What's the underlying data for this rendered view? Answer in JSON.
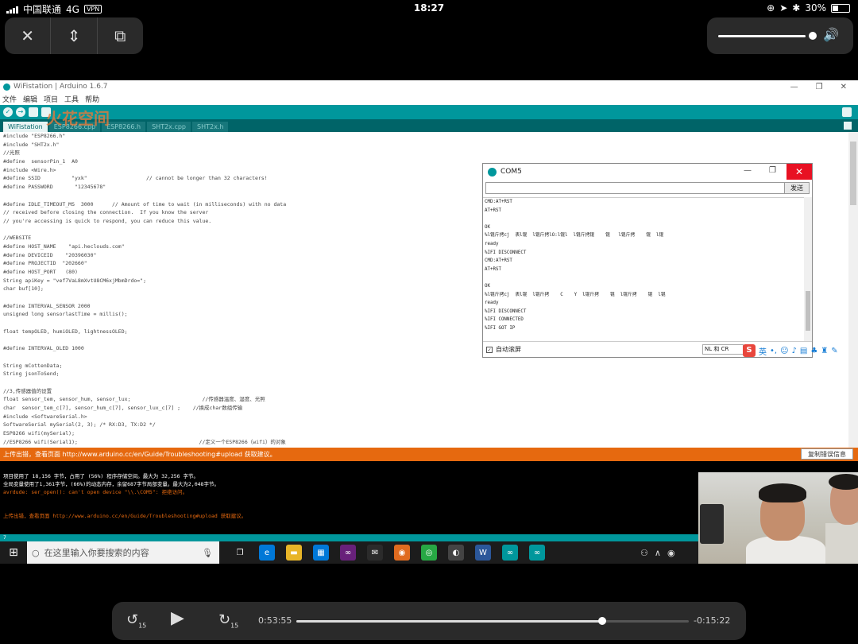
{
  "ios_status": {
    "carrier": "中国联通",
    "network": "4G",
    "vpn": "VPN",
    "time": "18:27",
    "battery": "30%"
  },
  "video_controls": {
    "close": "✕",
    "fullscreen": "⇕",
    "pip": "⧉",
    "volume_icon": "🔊"
  },
  "ide": {
    "title": "WiFistation | Arduino 1.6.7",
    "window_controls": [
      "—",
      "❐",
      "✕"
    ],
    "menu": [
      "文件",
      "编辑",
      "项目",
      "工具",
      "帮助"
    ],
    "watermark": "火花空间",
    "tabs": [
      "WiFistation",
      "ESP8266.cpp",
      "ESP8266.h",
      "SHT2x.cpp",
      "SHT2x.h"
    ],
    "code_lines": [
      "#include \"ESP8266.h\"",
      "#include \"SHT2x.h\"",
      "//光照",
      "#define  sensorPin_1  A0",
      "#include <Wire.h>",
      "#define SSID          \"yxk\"                   // cannot be longer than 32 characters!",
      "#define PASSWORD       \"12345678\"",
      "",
      "#define IDLE_TIMEOUT_MS  3000      // Amount of time to wait (in milliseconds) with no data",
      "// received before closing the connection.  If you know the server",
      "// you're accessing is quick to respond, you can reduce this value.",
      "",
      "//WEBSITE",
      "#define HOST_NAME    \"api.heclouds.com\"",
      "#define DEVICEID    \"20396030\"",
      "#define PROJECTID  \"202660\"",
      "#define HOST_PORT   (80)",
      "String apiKey = \"vef7VaL8mXvtU8CM6xjMbmDrdo=\";",
      "char buf[10];",
      "",
      "#define INTERVAL_SENSOR 2000",
      "unsigned long sensorlastTime = millis();",
      "",
      "float tempOLED, humiOLED, lightnessOLED;",
      "",
      "#define INTERVAL_OLED 1000",
      "",
      "String mCottenData;",
      "String jsonToSend;",
      "",
      "//3,传感器值的设置",
      "float sensor_tem, sensor_hum, sensor_lux;                       //传感器温度、湿度、光照",
      "char  sensor_tem_c[7], sensor_hum_c[7], sensor_lux_c[7] ;    //换成char数组传输",
      "#include <SoftwareSerial.h>",
      "SoftwareSerial mySerial(2, 3); /* RX:D3, TX:D2 */",
      "ESP8266 wifi(mySerial);",
      "//ESP8266 wifi(Serial1);                                       //定义一个ESP8266（wifi）的对象"
    ],
    "message_bar": "上传出错，查看页面 http://www.arduino.cc/en/Guide/Troubleshooting#upload 获取建议。",
    "copy_error_button": "复制错误信息",
    "console_lines": [
      "项目使用了 18,156 字节，占用了 (56%) 程序存储空间。最大为 32,256 字节。",
      "全局变量使用了1,361字节，(66%)的动态内存，余留687字节局部变量。最大为2,048字节。",
      "avrdude: ser_open(): can't open device \"\\\\.\\COM5\": 拒绝访问。",
      "",
      "",
      "上传出错，查看页面 http://www.arduino.cc/en/Guide/Troubleshooting#upload 获取建议。"
    ],
    "footer": "7"
  },
  "com_window": {
    "title": "COM5",
    "send_button": "发送",
    "input_value": "",
    "output_lines": [
      "CMD:AT+RST",
      "AT+RST",
      "",
      "OK",
      "%l锟斤拷cj  表l锟  l锟斤拷lO:l锟l  l锟斤拷锟    锟   l锟斤拷    锟  l锟",
      "ready",
      "%IFI DISCONNECT",
      "CMD:AT+RST",
      "AT+RST",
      "",
      "OK",
      "%l锟斤拷cj  表l锟  l锟斤拷    C    Y  l锟斤拷    锟  l锟斤拷    锟  l锟",
      "ready",
      "%IFI DISCONNECT",
      "%IFI CONNECTED",
      "%IFI GOT IP"
    ],
    "autoscroll_label": "自动滚屏",
    "line_ending": "NL 和 CR"
  },
  "ime_toolbar": {
    "logo": "S",
    "lang": "英"
  },
  "taskbar": {
    "search_placeholder": "在这里输入你要搜索的内容",
    "apps": [
      {
        "name": "task-view-icon",
        "glyph": "❐",
        "color": "#1c1c1c"
      },
      {
        "name": "edge-icon",
        "glyph": "e",
        "color": "#0078d7"
      },
      {
        "name": "file-explorer-icon",
        "glyph": "▬",
        "color": "#e8b528"
      },
      {
        "name": "store-icon",
        "glyph": "▦",
        "color": "#0078d7"
      },
      {
        "name": "visual-studio-icon",
        "glyph": "∞",
        "color": "#68217a"
      },
      {
        "name": "mail-icon",
        "glyph": "✉",
        "color": "#2b2b2b"
      },
      {
        "name": "app-icon",
        "glyph": "◉",
        "color": "#e06b1f"
      },
      {
        "name": "chrome-icon",
        "glyph": "◎",
        "color": "#27a844"
      },
      {
        "name": "app2-icon",
        "glyph": "◐",
        "color": "#444"
      },
      {
        "name": "word-icon",
        "glyph": "W",
        "color": "#2b579a"
      },
      {
        "name": "arduino-icon",
        "glyph": "∞",
        "color": "#00979c"
      },
      {
        "name": "arduino2-icon",
        "glyph": "∞",
        "color": "#00979c"
      }
    ]
  },
  "player": {
    "rewind": "15",
    "forward": "15",
    "elapsed": "0:53:55",
    "remaining": "-0:15:22",
    "progress": 0.78
  }
}
